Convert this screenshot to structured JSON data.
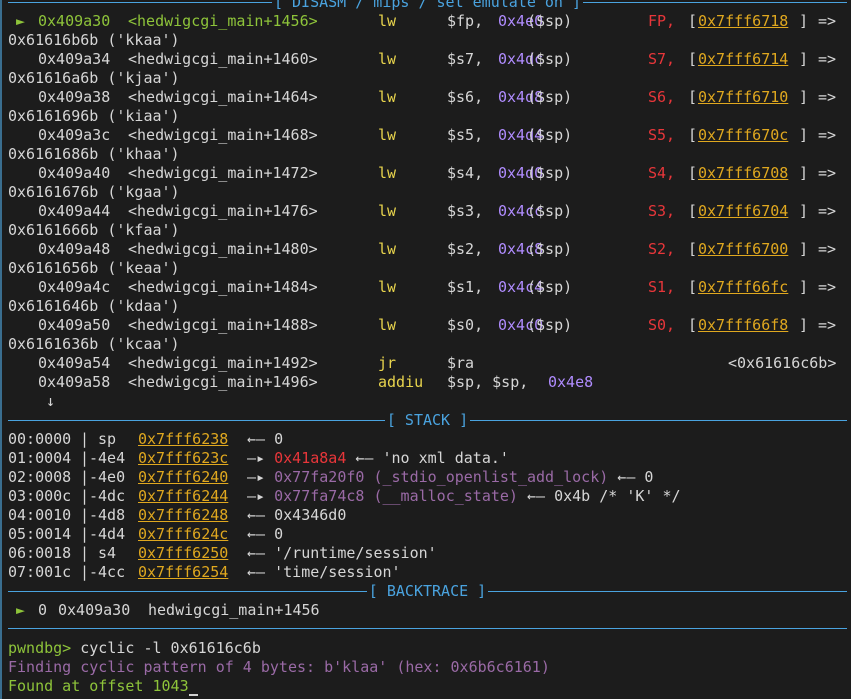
{
  "disasm": {
    "header": "[ DISASM / mips / set emulate on ]",
    "rows": [
      {
        "marker": "►",
        "addr": "0x409a30",
        "sym": "<hedwigcgi_main+1456>",
        "op": "lw",
        "dst": "$fp,",
        "off": "0x4e0",
        "base": "($sp)",
        "reg": "FP,",
        "ptr": "0x7fff6718",
        "arrow": "=>",
        "val": "0x61616b6b",
        "str": "('kkaa')"
      },
      {
        "marker": "",
        "addr": "0x409a34",
        "sym": "<hedwigcgi_main+1460>",
        "op": "lw",
        "dst": "$s7,",
        "off": "0x4dc",
        "base": "($sp)",
        "reg": "S7,",
        "ptr": "0x7fff6714",
        "arrow": "=>",
        "val": "0x61616a6b",
        "str": "('kjaa')"
      },
      {
        "marker": "",
        "addr": "0x409a38",
        "sym": "<hedwigcgi_main+1464>",
        "op": "lw",
        "dst": "$s6,",
        "off": "0x4d8",
        "base": "($sp)",
        "reg": "S6,",
        "ptr": "0x7fff6710",
        "arrow": "=>",
        "val": "0x6161696b",
        "str": "('kiaa')"
      },
      {
        "marker": "",
        "addr": "0x409a3c",
        "sym": "<hedwigcgi_main+1468>",
        "op": "lw",
        "dst": "$s5,",
        "off": "0x4d4",
        "base": "($sp)",
        "reg": "S5,",
        "ptr": "0x7fff670c",
        "arrow": "=>",
        "val": "0x6161686b",
        "str": "('khaa')"
      },
      {
        "marker": "",
        "addr": "0x409a40",
        "sym": "<hedwigcgi_main+1472>",
        "op": "lw",
        "dst": "$s4,",
        "off": "0x4d0",
        "base": "($sp)",
        "reg": "S4,",
        "ptr": "0x7fff6708",
        "arrow": "=>",
        "val": "0x6161676b",
        "str": "('kgaa')"
      },
      {
        "marker": "",
        "addr": "0x409a44",
        "sym": "<hedwigcgi_main+1476>",
        "op": "lw",
        "dst": "$s3,",
        "off": "0x4cc",
        "base": "($sp)",
        "reg": "S3,",
        "ptr": "0x7fff6704",
        "arrow": "=>",
        "val": "0x6161666b",
        "str": "('kfaa')"
      },
      {
        "marker": "",
        "addr": "0x409a48",
        "sym": "<hedwigcgi_main+1480>",
        "op": "lw",
        "dst": "$s2,",
        "off": "0x4c8",
        "base": "($sp)",
        "reg": "S2,",
        "ptr": "0x7fff6700",
        "arrow": "=>",
        "val": "0x6161656b",
        "str": "('keaa')"
      },
      {
        "marker": "",
        "addr": "0x409a4c",
        "sym": "<hedwigcgi_main+1484>",
        "op": "lw",
        "dst": "$s1,",
        "off": "0x4c4",
        "base": "($sp)",
        "reg": "S1,",
        "ptr": "0x7fff66fc",
        "arrow": "=>",
        "val": "0x6161646b",
        "str": "('kdaa')"
      },
      {
        "marker": "",
        "addr": "0x409a50",
        "sym": "<hedwigcgi_main+1488>",
        "op": "lw",
        "dst": "$s0,",
        "off": "0x4c0",
        "base": "($sp)",
        "reg": "S0,",
        "ptr": "0x7fff66f8",
        "arrow": "=>",
        "val": "0x6161636b",
        "str": "('kcaa')"
      }
    ],
    "jr": {
      "addr": "0x409a54",
      "sym": "<hedwigcgi_main+1492>",
      "op": "jr",
      "arg": "$ra",
      "target": "<0x61616c6b>"
    },
    "addiu": {
      "addr": "0x409a58",
      "sym": "<hedwigcgi_main+1496>",
      "op": "addiu",
      "arg1": "$sp, $sp,",
      "arg2": "0x4e8"
    },
    "down_arrow": "↓"
  },
  "stack": {
    "header": "[ STACK ]",
    "rows": [
      {
        "idx": "00:0000",
        "reg": " sp",
        "ptr": "0x7fff6238",
        "rest": [
          {
            "t": " ←— 0",
            "c": "c-white"
          }
        ]
      },
      {
        "idx": "01:0004",
        "reg": "-4e4",
        "ptr": "0x7fff623c",
        "rest": [
          {
            "t": " —▸ ",
            "c": "c-white"
          },
          {
            "t": "0x41a8a4",
            "c": "c-red"
          },
          {
            "t": " ←— 'no xml data.'",
            "c": "c-white"
          }
        ]
      },
      {
        "idx": "02:0008",
        "reg": "-4e0",
        "ptr": "0x7fff6240",
        "rest": [
          {
            "t": " —▸ ",
            "c": "c-white"
          },
          {
            "t": "0x77fa20f0 (_stdio_openlist_add_lock)",
            "c": "c-dim"
          },
          {
            "t": " ←— 0",
            "c": "c-white"
          }
        ]
      },
      {
        "idx": "03:000c",
        "reg": "-4dc",
        "ptr": "0x7fff6244",
        "rest": [
          {
            "t": " —▸ ",
            "c": "c-white"
          },
          {
            "t": "0x77fa74c8 (__malloc_state)",
            "c": "c-dim"
          },
          {
            "t": " ←— 0x4b /* 'K' */",
            "c": "c-white"
          }
        ]
      },
      {
        "idx": "04:0010",
        "reg": "-4d8",
        "ptr": "0x7fff6248",
        "rest": [
          {
            "t": " ←— 0x4346d0",
            "c": "c-white"
          }
        ]
      },
      {
        "idx": "05:0014",
        "reg": "-4d4",
        "ptr": "0x7fff624c",
        "rest": [
          {
            "t": " ←— 0",
            "c": "c-white"
          }
        ]
      },
      {
        "idx": "06:0018",
        "reg": " s4",
        "ptr": "0x7fff6250",
        "rest": [
          {
            "t": " ←— '/runtime/session'",
            "c": "c-white"
          }
        ]
      },
      {
        "idx": "07:001c",
        "reg": "-4cc",
        "ptr": "0x7fff6254",
        "rest": [
          {
            "t": " ←— 'time/session'",
            "c": "c-white"
          }
        ]
      }
    ]
  },
  "backtrace": {
    "header": "[ BACKTRACE ]",
    "marker": "►",
    "frame": "0",
    "addr": "0x409a30",
    "sym": "hedwigcgi_main+1456"
  },
  "console": {
    "prompt": "pwndbg>",
    "command": "cyclic -l 0x61616c6b",
    "finding": "Finding cyclic pattern of 4 bytes: b'klaa' (hex: 0x6b6c6161)",
    "found_prefix": "Found at",
    "found_rest": "offset 1043"
  }
}
